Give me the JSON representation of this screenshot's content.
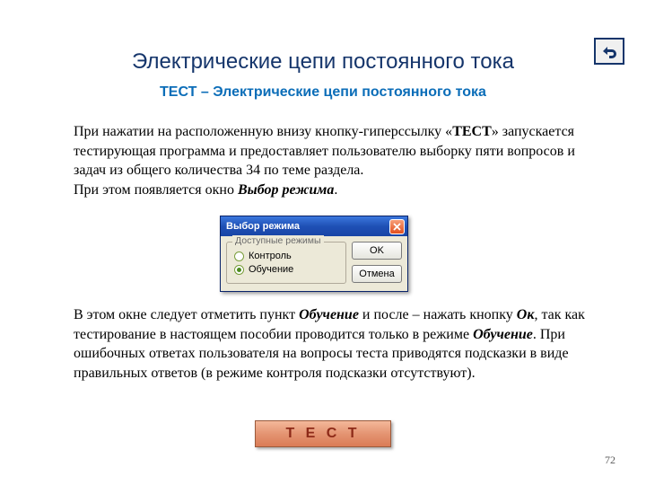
{
  "page": {
    "title": "Электрические цепи постоянного тока",
    "subtitle": "ТЕСТ – Электрические цепи постоянного тока",
    "number": "72"
  },
  "para1": {
    "t1": "При нажатии на расположенную внизу кнопку-гиперссылку «",
    "t_bold": "ТЕСТ",
    "t2": "» запускается тестирующая программа и предоставляет пользователю выборку пяти вопросов и задач из общего количества 34 по теме раздела.",
    "line2a": "При этом появляется окно ",
    "line2b": "Выбор режима",
    "line2c": "."
  },
  "dialog": {
    "title": "Выбор режима",
    "group_legend": "Доступные режимы",
    "opt1": "Контроль",
    "opt2": "Обучение",
    "ok": "OK",
    "cancel": "Отмена"
  },
  "para2": {
    "t1": "В этом окне следует отметить пункт ",
    "i1": "Обучение",
    "t2": " и после – нажать кнопку ",
    "i2": "Ок",
    "t3": ", так как тестирование в настоящем пособии проводится только в режиме ",
    "i3": "Обучение",
    "t4": ". При ошибочных ответах пользователя на вопросы теста приводятся подсказки в виде правильных ответов (в режиме контроля подсказки отсутствуют)."
  },
  "test_button": "Т Е С Т"
}
